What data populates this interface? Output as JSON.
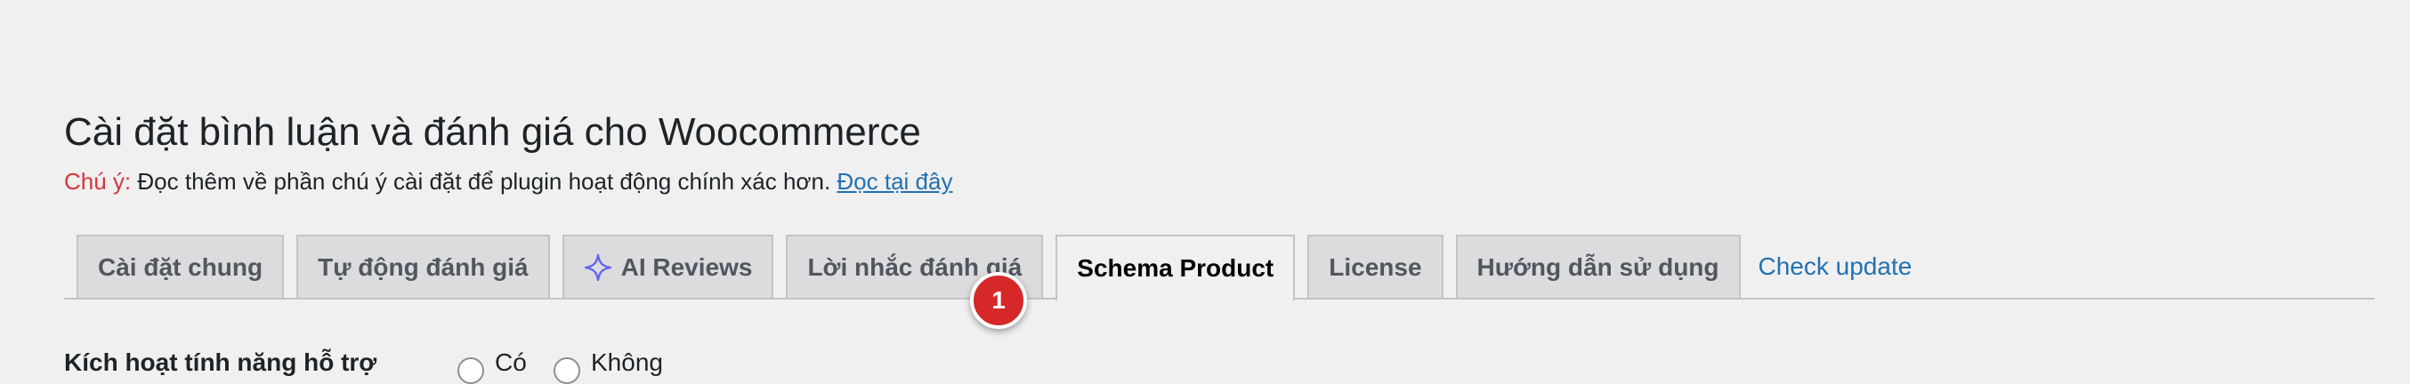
{
  "page": {
    "title": "Cài đặt bình luận và đánh giá cho Woocommerce"
  },
  "notice": {
    "label": "Chú ý:",
    "text": " Đọc thêm về phần chú ý cài đặt để plugin hoạt động chính xác hơn. ",
    "link": "Đọc tại đây"
  },
  "tabs": [
    {
      "label": "Cài đặt chung",
      "active": false
    },
    {
      "label": "Tự động đánh giá",
      "active": false
    },
    {
      "label": "AI Reviews",
      "active": false,
      "icon": "sparkle-icon"
    },
    {
      "label": "Lời nhắc đánh giá",
      "active": false
    },
    {
      "label": "Schema Product",
      "active": true
    },
    {
      "label": "License",
      "active": false
    },
    {
      "label": "Hướng dẫn sử dụng",
      "active": false
    }
  ],
  "check_update_label": "Check update",
  "step_badge": "1",
  "setting": {
    "label": "Kích hoạt tính năng hỗ trợ",
    "options": [
      "Có",
      "Không"
    ]
  },
  "colors": {
    "notice_label": "#d63638",
    "link": "#2271b1",
    "badge": "#d62828",
    "sparkle": "#6366f1"
  }
}
